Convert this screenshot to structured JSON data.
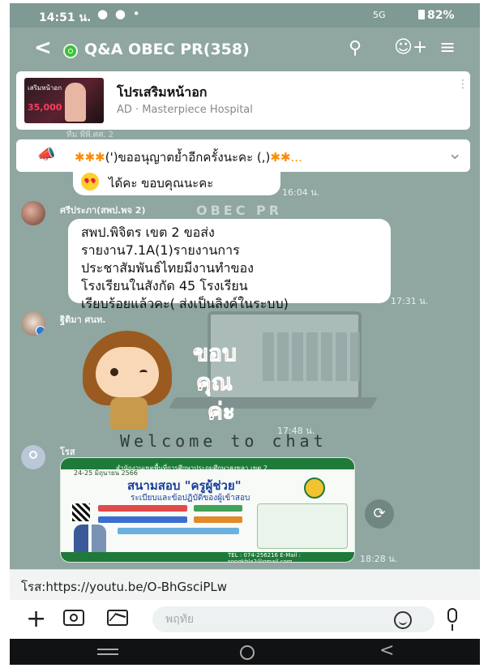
{
  "status_bar": {
    "time": "14:51 น.",
    "icons": "● ● •",
    "network": "5G",
    "battery": "82%"
  },
  "header": {
    "title": "Q&A OBEC PR(358)",
    "icons": [
      "back-icon",
      "group-icon",
      "search-icon",
      "add-friend-icon",
      "menu-icon"
    ]
  },
  "ad": {
    "title": "โปรเสริมหน้าอก",
    "subtitle": "AD · Masterpiece Hospital",
    "thumb_tag": "เสริมหน้าอก",
    "thumb_price": "35,000"
  },
  "announcement": {
    "stars_left": "✱✱✱",
    "text": "(')ขออนุญาตย้ำอีกครั้งนะคะ (,)",
    "stars_right": "✱✱...",
    "partial_above": "ทีม พีพี.ศศ. 2"
  },
  "messages": [
    {
      "text": "ได้คะ ขอบคุณนะคะ",
      "time": "16:04 น."
    },
    {
      "sender": "ศรีประภา(สพป.พจ 2)",
      "lines": [
        "สพป.พิจิตร เขต 2 ขอส่ง",
        "รายงาน7.1A(1)รายงานการ",
        "ประชาสัมพันธ์ไทยมีงานทำของ",
        "โรงเรียนในสังกัด 45 โรงเรียน",
        "เรียบร้อยแล้วคะ( ส่งเป็นลิงค์ในระบบ)"
      ],
      "time": "17:31 น."
    },
    {
      "sender": "ฐิติมา ศนท.",
      "sticker_words": [
        "ขอบ",
        "คุณ",
        "ค่ะ"
      ],
      "time": "17:48 น."
    },
    {
      "sender": "โรส",
      "poster": {
        "header": "สำนักงานเขตพื้นที่การศึกษาประถมศึกษาสงขลา เขต 2",
        "date": "24-25 มิถุนายน 2566",
        "title": "สนามสอบ \"ครูผู้ช่วย\"",
        "subtitle": "ระเบียบและข้อปฏิบัติของผู้เข้าสอบ",
        "footer": "TEL : 074-256216   E-Mail : songkhla2@gmail.com"
      },
      "time": "18:28 น."
    }
  ],
  "background": {
    "watermark": "OBEC PR",
    "welcome": "Welcome to chat"
  },
  "link_preview": {
    "text": "โรส:https://youtu.be/O-BhGsciPLw"
  },
  "input_bar": {
    "placeholder": "พฤทัย"
  },
  "colors": {
    "chat_bg": "#8fa6a1",
    "line_green": "#3cc13b",
    "bubble": "#ffffff"
  }
}
